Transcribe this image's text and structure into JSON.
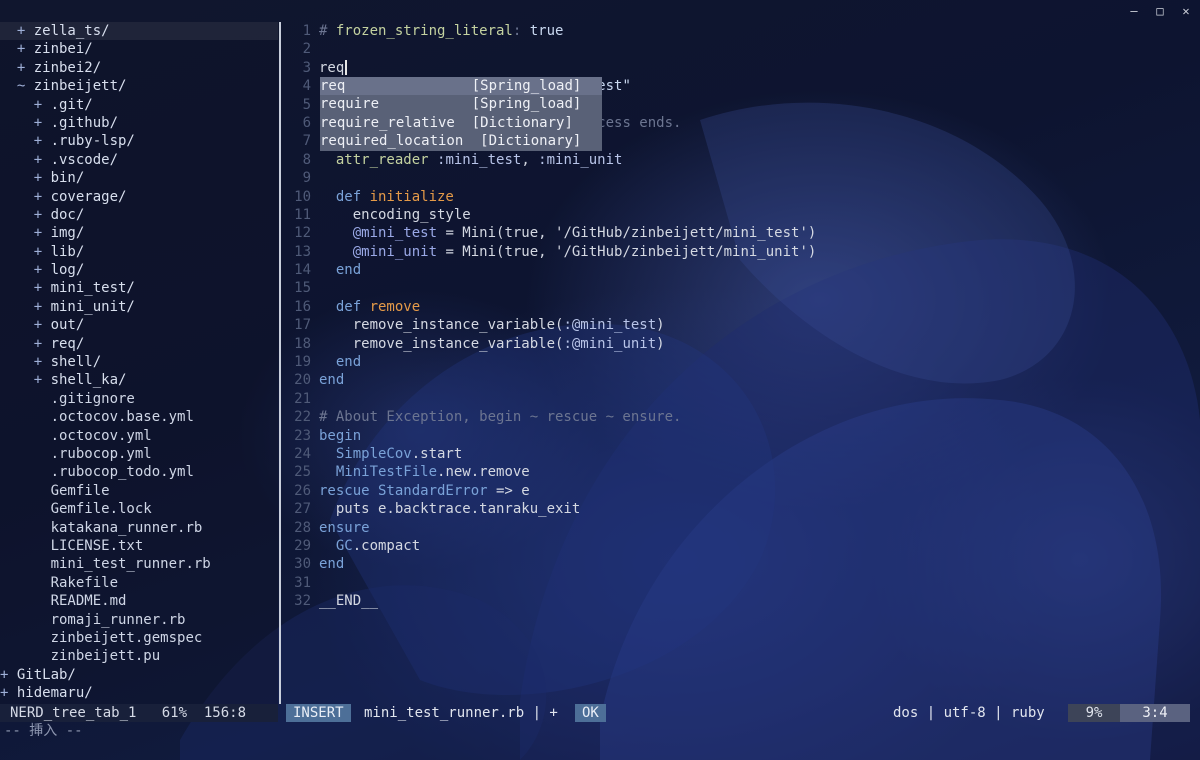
{
  "window": {
    "controls": [
      "—",
      "□",
      "✕"
    ]
  },
  "tree": [
    {
      "indent": "  ",
      "mk": "+ ",
      "name": "zella_ts/",
      "dir": true,
      "sel": true
    },
    {
      "indent": "  ",
      "mk": "+ ",
      "name": "zinbei/",
      "dir": true
    },
    {
      "indent": "  ",
      "mk": "+ ",
      "name": "zinbei2/",
      "dir": true
    },
    {
      "indent": "  ",
      "mk": "~ ",
      "name": "zinbeijett/",
      "dir": true
    },
    {
      "indent": "    ",
      "mk": "+ ",
      "name": ".git/",
      "dir": true
    },
    {
      "indent": "    ",
      "mk": "+ ",
      "name": ".github/",
      "dir": true
    },
    {
      "indent": "    ",
      "mk": "+ ",
      "name": ".ruby-lsp/",
      "dir": true
    },
    {
      "indent": "    ",
      "mk": "+ ",
      "name": ".vscode/",
      "dir": true
    },
    {
      "indent": "    ",
      "mk": "+ ",
      "name": "bin/",
      "dir": true
    },
    {
      "indent": "    ",
      "mk": "+ ",
      "name": "coverage/",
      "dir": true
    },
    {
      "indent": "    ",
      "mk": "+ ",
      "name": "doc/",
      "dir": true
    },
    {
      "indent": "    ",
      "mk": "+ ",
      "name": "img/",
      "dir": true
    },
    {
      "indent": "    ",
      "mk": "+ ",
      "name": "lib/",
      "dir": true
    },
    {
      "indent": "    ",
      "mk": "+ ",
      "name": "log/",
      "dir": true
    },
    {
      "indent": "    ",
      "mk": "+ ",
      "name": "mini_test/",
      "dir": true
    },
    {
      "indent": "    ",
      "mk": "+ ",
      "name": "mini_unit/",
      "dir": true
    },
    {
      "indent": "    ",
      "mk": "+ ",
      "name": "out/",
      "dir": true
    },
    {
      "indent": "    ",
      "mk": "+ ",
      "name": "req/",
      "dir": true
    },
    {
      "indent": "    ",
      "mk": "+ ",
      "name": "shell/",
      "dir": true
    },
    {
      "indent": "    ",
      "mk": "+ ",
      "name": "shell_ka/",
      "dir": true
    },
    {
      "indent": "      ",
      "mk": "",
      "name": ".gitignore"
    },
    {
      "indent": "      ",
      "mk": "",
      "name": ".octocov.base.yml"
    },
    {
      "indent": "      ",
      "mk": "",
      "name": ".octocov.yml"
    },
    {
      "indent": "      ",
      "mk": "",
      "name": ".rubocop.yml"
    },
    {
      "indent": "      ",
      "mk": "",
      "name": ".rubocop_todo.yml"
    },
    {
      "indent": "      ",
      "mk": "",
      "name": "Gemfile"
    },
    {
      "indent": "      ",
      "mk": "",
      "name": "Gemfile.lock"
    },
    {
      "indent": "      ",
      "mk": "",
      "name": "katakana_runner.rb"
    },
    {
      "indent": "      ",
      "mk": "",
      "name": "LICENSE.txt"
    },
    {
      "indent": "      ",
      "mk": "",
      "name": "mini_test_runner.rb"
    },
    {
      "indent": "      ",
      "mk": "",
      "name": "Rakefile"
    },
    {
      "indent": "      ",
      "mk": "",
      "name": "README.md"
    },
    {
      "indent": "      ",
      "mk": "",
      "name": "romaji_runner.rb"
    },
    {
      "indent": "      ",
      "mk": "",
      "name": "zinbeijett.gemspec"
    },
    {
      "indent": "      ",
      "mk": "",
      "name": "zinbeijett.pu"
    },
    {
      "indent": "",
      "mk": "+ ",
      "name": "GitLab/",
      "dir": true
    },
    {
      "indent": "",
      "mk": "+ ",
      "name": "hidemaru/",
      "dir": true
    }
  ],
  "editor": {
    "lines": [
      {
        "n": "1",
        "segs": [
          [
            "c-com",
            "# "
          ],
          [
            "c-hd",
            "frozen_string_literal"
          ],
          [
            "c-com",
            ": "
          ],
          [
            "c-str",
            "true"
          ]
        ]
      },
      {
        "n": "2",
        "segs": []
      },
      {
        "n": "3",
        "segs": [
          [
            "code",
            "req"
          ]
        ],
        "cursor": true
      },
      {
        "n": "4",
        "segs": [
          [
            "code",
            "                     "
          ],
          [
            "c-str",
            ")}/req/minitest\""
          ]
        ]
      },
      {
        "n": "5",
        "segs": []
      },
      {
        "n": "6",
        "segs": [
          [
            "code",
            "                     "
          ],
          [
            "c-com",
            "ed after process ends."
          ]
        ]
      },
      {
        "n": "7",
        "segs": []
      },
      {
        "n": "8",
        "segs": [
          [
            "code",
            "  "
          ],
          [
            "c-hd",
            "attr_reader"
          ],
          [
            "code",
            " "
          ],
          [
            "c-sym",
            ":mini_test"
          ],
          [
            "code",
            ", "
          ],
          [
            "c-sym",
            ":mini_unit"
          ]
        ]
      },
      {
        "n": "9",
        "segs": []
      },
      {
        "n": "10",
        "segs": [
          [
            "code",
            "  "
          ],
          [
            "c-key",
            "def "
          ],
          [
            "c-def",
            "initialize"
          ]
        ]
      },
      {
        "n": "11",
        "segs": [
          [
            "code",
            "    encoding_style"
          ]
        ]
      },
      {
        "n": "12",
        "segs": [
          [
            "code",
            "    "
          ],
          [
            "c-var",
            "@mini_test"
          ],
          [
            "code",
            " = Mini(true, '/GitHub/zinbeijett/mini_test')"
          ]
        ]
      },
      {
        "n": "13",
        "segs": [
          [
            "code",
            "    "
          ],
          [
            "c-var",
            "@mini_unit"
          ],
          [
            "code",
            " = Mini(true, '/GitHub/zinbeijett/mini_unit')"
          ]
        ]
      },
      {
        "n": "14",
        "segs": [
          [
            "code",
            "  "
          ],
          [
            "c-key",
            "end"
          ]
        ]
      },
      {
        "n": "15",
        "segs": []
      },
      {
        "n": "16",
        "segs": [
          [
            "code",
            "  "
          ],
          [
            "c-key",
            "def "
          ],
          [
            "c-def",
            "remove"
          ]
        ]
      },
      {
        "n": "17",
        "segs": [
          [
            "code",
            "    remove_instance_variable("
          ],
          [
            "c-sym",
            ":@mini_test"
          ],
          [
            "code",
            ")"
          ]
        ]
      },
      {
        "n": "18",
        "segs": [
          [
            "code",
            "    remove_instance_variable("
          ],
          [
            "c-sym",
            ":@mini_unit"
          ],
          [
            "code",
            ")"
          ]
        ]
      },
      {
        "n": "19",
        "segs": [
          [
            "code",
            "  "
          ],
          [
            "c-key",
            "end"
          ]
        ]
      },
      {
        "n": "20",
        "segs": [
          [
            "c-key",
            "end"
          ]
        ]
      },
      {
        "n": "21",
        "segs": []
      },
      {
        "n": "22",
        "segs": [
          [
            "c-com",
            "# About Exception, begin ~ rescue ~ ensure."
          ]
        ]
      },
      {
        "n": "23",
        "segs": [
          [
            "c-key",
            "begin"
          ]
        ]
      },
      {
        "n": "24",
        "segs": [
          [
            "code",
            "  "
          ],
          [
            "c-key",
            "SimpleCov"
          ],
          [
            "code",
            ".start"
          ]
        ]
      },
      {
        "n": "25",
        "segs": [
          [
            "code",
            "  "
          ],
          [
            "c-key",
            "MiniTestFile"
          ],
          [
            "code",
            ".new.remove"
          ]
        ]
      },
      {
        "n": "26",
        "segs": [
          [
            "c-key",
            "rescue StandardError"
          ],
          [
            "code",
            " => e"
          ]
        ]
      },
      {
        "n": "27",
        "segs": [
          [
            "code",
            "  puts e.backtrace.tanraku_exit"
          ]
        ]
      },
      {
        "n": "28",
        "segs": [
          [
            "c-key",
            "ensure"
          ]
        ]
      },
      {
        "n": "29",
        "segs": [
          [
            "code",
            "  "
          ],
          [
            "c-key",
            "GC"
          ],
          [
            "code",
            ".compact"
          ]
        ]
      },
      {
        "n": "30",
        "segs": [
          [
            "c-key",
            "end"
          ]
        ]
      },
      {
        "n": "31",
        "segs": []
      },
      {
        "n": "32",
        "segs": [
          [
            "code",
            "__END__"
          ]
        ]
      }
    ]
  },
  "completion": [
    {
      "word": "req              ",
      "kind": "[Spring_load]",
      "sel": true
    },
    {
      "word": "require          ",
      "kind": "[Spring_load]"
    },
    {
      "word": "require_relative ",
      "kind": "[Dictionary]"
    },
    {
      "word": "required_location",
      "kind": " [Dictionary]"
    }
  ],
  "status": {
    "left": "NERD_tree_tab_1   61%  156:8",
    "mode": "INSERT",
    "file": "mini_test_runner.rb | +",
    "ok": "OK",
    "right": "dos | utf-8 | ruby",
    "pct": "9%",
    "pos": "3:4"
  },
  "cmdline": "-- 挿入 --"
}
